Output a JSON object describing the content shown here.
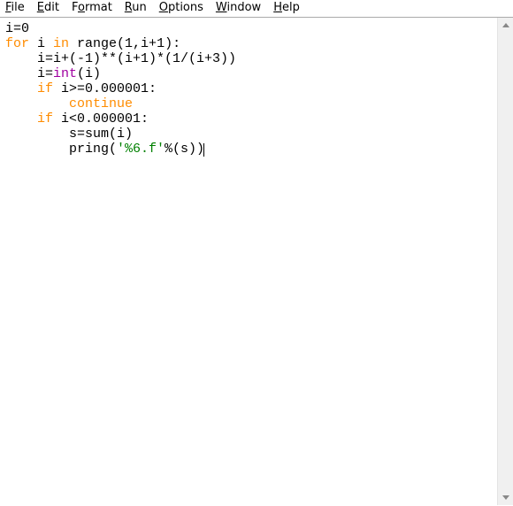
{
  "menubar": {
    "file": {
      "accel": "F",
      "rest": "ile"
    },
    "edit": {
      "accel": "E",
      "rest": "dit"
    },
    "format": {
      "pre": "F",
      "accel": "o",
      "rest": "rmat"
    },
    "run": {
      "accel": "R",
      "rest": "un"
    },
    "options": {
      "accel": "O",
      "rest": "ptions"
    },
    "window": {
      "accel": "W",
      "rest": "indow"
    },
    "help": {
      "accel": "H",
      "rest": "elp"
    }
  },
  "code": {
    "line1": {
      "a": "i=0"
    },
    "line2": {
      "kw1": "for",
      "b": " i ",
      "kw2": "in",
      "c": " range(1,i+1):"
    },
    "line3": {
      "a": "    i=i+(-1)**(i+1)*(1/(i+3))"
    },
    "line4": {
      "a": "    i=",
      "bi": "int",
      "b": "(i)"
    },
    "line5": {
      "a": "    ",
      "kw": "if",
      "b": " i>=0.000001:"
    },
    "line6": {
      "a": "        ",
      "kw": "continue"
    },
    "line7": {
      "a": "    ",
      "kw": "if",
      "b": " i<0.000001:"
    },
    "line8": {
      "a": "        s=sum(i)"
    },
    "line9": {
      "a": "        pring(",
      "str": "'%6.f'",
      "b": "%(s))"
    }
  }
}
